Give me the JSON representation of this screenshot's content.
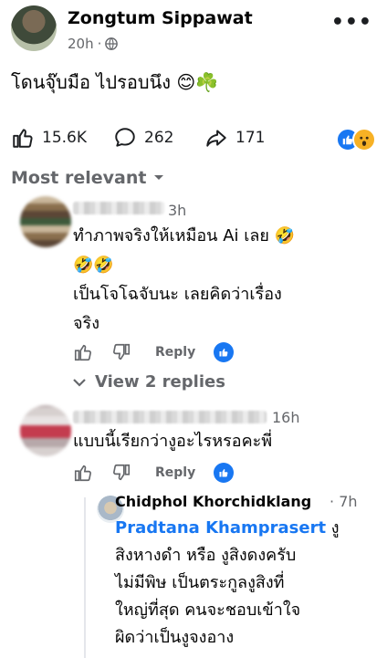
{
  "post": {
    "author": "Zongtum Sippawat",
    "time": "20h",
    "separator": "·",
    "privacy_icon": "globe-icon",
    "more_label": "•••",
    "text": "โดนจุ๊บมือ ไปรอบนึง 😊☘️"
  },
  "actions": {
    "likes": "15.6K",
    "comments": "262",
    "shares": "171",
    "reactions": [
      "like",
      "wow"
    ]
  },
  "sort_label": "Most relevant",
  "comments": [
    {
      "time": "3h",
      "text_lines": [
        "ทำภาพจริงให้เหมือน Ai เลย 🤣",
        "🤣🤣",
        "เป็นโจโฉจับนะ เลยคิดว่าเรื่อง",
        "จริง"
      ],
      "reply_label": "Reply"
    },
    {
      "time": "16h",
      "text_lines": [
        "แบบนี้เรียกว่างูอะไรหรอคะพี่"
      ],
      "reply_label": "Reply"
    }
  ],
  "view_replies": "View 2 replies",
  "reply": {
    "name": "Chidphol Khorchidklang",
    "separator": "·",
    "time": "7h",
    "mention": "Pradtana Khamprasert",
    "line1_rest": " งู",
    "lines": [
      "สิงหางดำ หรือ งูสิงดงครับ",
      "ไม่มีพิษ เป็นตระกูลงูสิงที่",
      "ใหญ่ที่สุด คนจะชอบเข้าใจ",
      "ผิดว่าเป็นงูจงอาง"
    ]
  },
  "colors": {
    "accent": "#1877f2",
    "secondary_text": "#65676b",
    "reaction_wow": "#f7b125"
  }
}
